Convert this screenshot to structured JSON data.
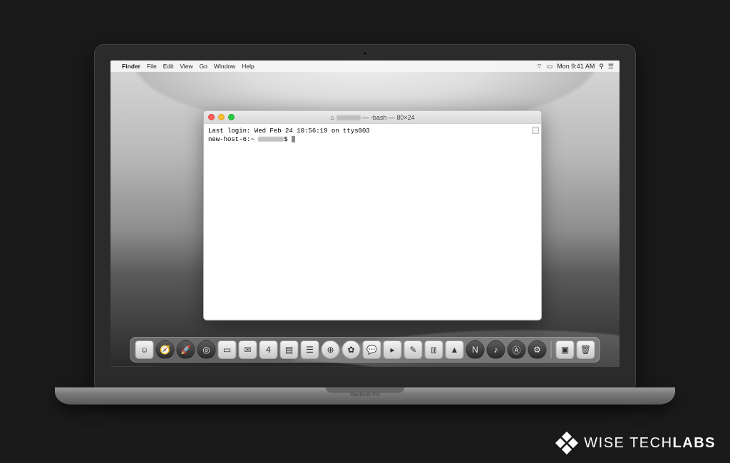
{
  "menubar": {
    "app": "Finder",
    "items": [
      "File",
      "Edit",
      "View",
      "Go",
      "Window",
      "Help"
    ],
    "clock": "Mon 9:41 AM"
  },
  "terminal": {
    "title_suffix": " — -bash — 80×24",
    "line1": "Last login: Wed Feb 24 10:56:19 on ttys003",
    "prompt_host": "new-host-6:~",
    "prompt_sep": "$"
  },
  "dock_icons": [
    {
      "name": "finder-icon",
      "glyph": "☺",
      "dark": false
    },
    {
      "name": "safari-icon",
      "glyph": "🧭",
      "dark": true,
      "round": true
    },
    {
      "name": "launchpad-icon",
      "glyph": "🚀",
      "dark": true,
      "round": true
    },
    {
      "name": "safari2-icon",
      "glyph": "◎",
      "dark": true,
      "round": true
    },
    {
      "name": "contacts-icon",
      "glyph": "▭",
      "dark": false
    },
    {
      "name": "mail-icon",
      "glyph": "✉",
      "dark": false
    },
    {
      "name": "calendar-icon",
      "glyph": "4",
      "dark": false
    },
    {
      "name": "notes-icon",
      "glyph": "▤",
      "dark": false
    },
    {
      "name": "reminders-icon",
      "glyph": "☰",
      "dark": false
    },
    {
      "name": "maps-icon",
      "glyph": "⊕",
      "dark": false,
      "round": true
    },
    {
      "name": "photos-icon",
      "glyph": "✿",
      "dark": false,
      "round": true
    },
    {
      "name": "messages-icon",
      "glyph": "💬",
      "dark": false
    },
    {
      "name": "facetime-icon",
      "glyph": "▸",
      "dark": false
    },
    {
      "name": "pages-icon",
      "glyph": "✎",
      "dark": false
    },
    {
      "name": "numbers-icon",
      "glyph": "⫾⫾",
      "dark": false
    },
    {
      "name": "keynote-icon",
      "glyph": "▲",
      "dark": false
    },
    {
      "name": "news-icon",
      "glyph": "N",
      "dark": true,
      "round": true
    },
    {
      "name": "itunes-icon",
      "glyph": "♪",
      "dark": true,
      "round": true
    },
    {
      "name": "appstore-icon",
      "glyph": "Ⓐ",
      "dark": true,
      "round": true
    },
    {
      "name": "preferences-icon",
      "glyph": "⚙",
      "dark": true,
      "round": true
    }
  ],
  "dock_right": [
    {
      "name": "downloads-icon",
      "glyph": "▣",
      "dark": false
    },
    {
      "name": "trash-icon",
      "glyph": "🗑",
      "dark": false
    }
  ],
  "laptop_label": "MacBook Pro",
  "watermark": {
    "a": "WISE TECH",
    "b": " LABS"
  }
}
